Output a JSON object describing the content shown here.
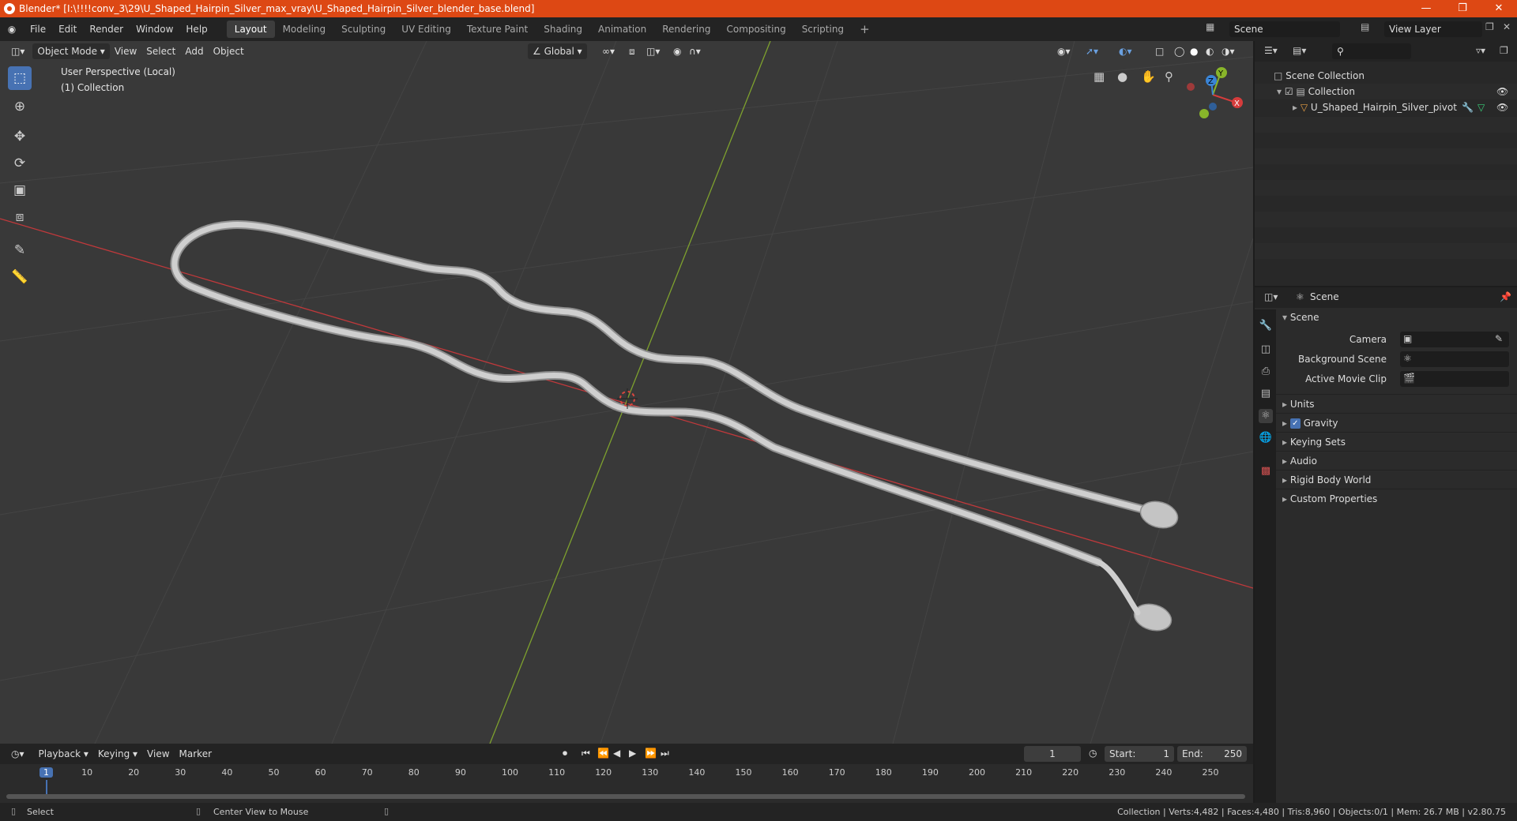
{
  "title_bar": {
    "title": "Blender* [I:\\!!!!conv_3\\29\\U_Shaped_Hairpin_Silver_max_vray\\U_Shaped_Hairpin_Silver_blender_base.blend]"
  },
  "menus": [
    "File",
    "Edit",
    "Render",
    "Window",
    "Help"
  ],
  "workspaces": [
    "Layout",
    "Modeling",
    "Sculpting",
    "UV Editing",
    "Texture Paint",
    "Shading",
    "Animation",
    "Rendering",
    "Compositing",
    "Scripting"
  ],
  "active_workspace": "Layout",
  "scene_field": "Scene",
  "view_layer_field": "View Layer",
  "viewport_header": {
    "mode": "Object Mode",
    "menus": [
      "View",
      "Select",
      "Add",
      "Object"
    ],
    "transform": "Global"
  },
  "viewport_info": {
    "line1": "User Perspective (Local)",
    "line2": "(1) Collection"
  },
  "gizmo": {
    "x": "X",
    "y": "Y",
    "z": "Z"
  },
  "outliner": {
    "root": "Scene Collection",
    "collection": "Collection",
    "object": "U_Shaped_Hairpin_Silver_pivot"
  },
  "properties": {
    "header": "Scene",
    "panel": "Scene",
    "camera_label": "Camera",
    "background_scene_label": "Background Scene",
    "active_movie_clip_label": "Active Movie Clip",
    "sections": [
      "Units",
      "Gravity",
      "Keying Sets",
      "Audio",
      "Rigid Body World",
      "Custom Properties"
    ],
    "gravity_checked": true
  },
  "timeline": {
    "menus": [
      "Playback",
      "Keying",
      "View",
      "Marker"
    ],
    "current_frame": "1",
    "start_label": "Start:",
    "start": "1",
    "end_label": "End:",
    "end": "250",
    "ruler": [
      "1",
      "10",
      "20",
      "30",
      "40",
      "50",
      "60",
      "70",
      "80",
      "90",
      "100",
      "110",
      "120",
      "130",
      "140",
      "150",
      "160",
      "170",
      "180",
      "190",
      "200",
      "210",
      "220",
      "230",
      "240",
      "250"
    ]
  },
  "status_bar": {
    "left_action": "Select",
    "middle_action": "Center View to Mouse",
    "stats": "Collection | Verts:4,482 | Faces:4,480 | Tris:8,960 | Objects:0/1 | Mem: 26.7 MB | v2.80.75"
  },
  "colors": {
    "title_bar": "#dd4814",
    "accent": "#4772b3",
    "x_axis": "#d63c3c",
    "y_axis": "#88b52a",
    "z_axis": "#3a84d6"
  }
}
